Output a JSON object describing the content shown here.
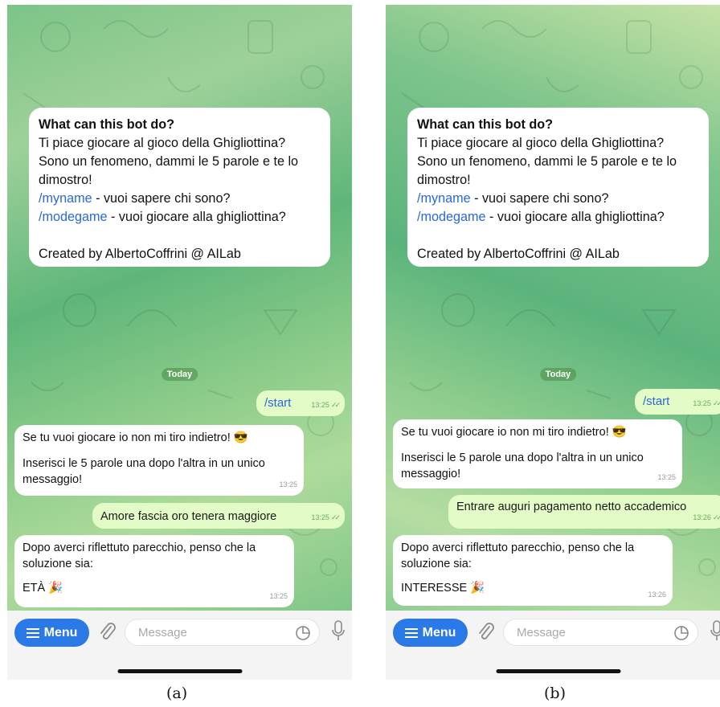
{
  "panels": [
    {
      "caption": "(a)",
      "bot_info": {
        "title": "What can this bot do?",
        "line1": "Ti piace giocare al gioco della Ghigliottina?",
        "line2": "Sono un fenomeno, dammi le 5 parole e te lo dimostro!",
        "cmd1": "/myname",
        "cmd1_desc": " - vuoi sapere chi sono?",
        "cmd2": "/modegame",
        "cmd2_desc": " - vuoi giocare alla ghigliottina?",
        "credit": "Created by AlbertoCoffrini @ AILab"
      },
      "date_label": "Today",
      "messages": {
        "start_text": "/start",
        "start_time": "13:25",
        "reply1_line1": "Se tu vuoi giocare io non mi tiro indietro! 😎",
        "reply1_line2": "Inserisci le 5 parole una dopo l'altra in un unico messaggio!",
        "reply1_time": "13:25",
        "words_text": "Amore fascia oro tenera maggiore",
        "words_time": "13:25",
        "reply2_line1": "Dopo averci riflettuto parecchio, penso che la soluzione sia:",
        "reply2_answer": "ETÀ 🎉",
        "reply2_time": "13:25"
      },
      "input": {
        "menu_label": "Menu",
        "placeholder": "Message"
      }
    },
    {
      "caption": "(b)",
      "bot_info": {
        "title": "What can this bot do?",
        "line1": "Ti piace giocare al gioco della Ghigliottina?",
        "line2": "Sono un fenomeno, dammi le 5 parole e te lo dimostro!",
        "cmd1": "/myname",
        "cmd1_desc": " - vuoi sapere chi sono?",
        "cmd2": "/modegame",
        "cmd2_desc": " - vuoi giocare alla ghigliottina?",
        "credit": "Created by AlbertoCoffrini @ AILab"
      },
      "date_label": "Today",
      "messages": {
        "start_text": "/start",
        "start_time": "13:25",
        "reply1_line1": "Se tu vuoi giocare io non mi tiro indietro! 😎",
        "reply1_line2": "Inserisci le 5 parole una dopo l'altra in un unico messaggio!",
        "reply1_time": "13:25",
        "words_text": "Entrare auguri pagamento netto accademico",
        "words_time": "13:26",
        "reply2_line1": "Dopo averci riflettuto parecchio, penso che la soluzione sia:",
        "reply2_answer": "INTERESSE 🎉",
        "reply2_time": "13:26"
      },
      "input": {
        "menu_label": "Menu",
        "placeholder": "Message"
      }
    }
  ],
  "colors": {
    "accent_blue": "#2a79e6",
    "command_link": "#2a68d6",
    "outgoing_bubble": "#e3fbc7",
    "read_check": "#5fb05a"
  },
  "icons": [
    "menu-icon",
    "paperclip-icon",
    "sticker-icon",
    "microphone-icon",
    "double-check-icon"
  ]
}
